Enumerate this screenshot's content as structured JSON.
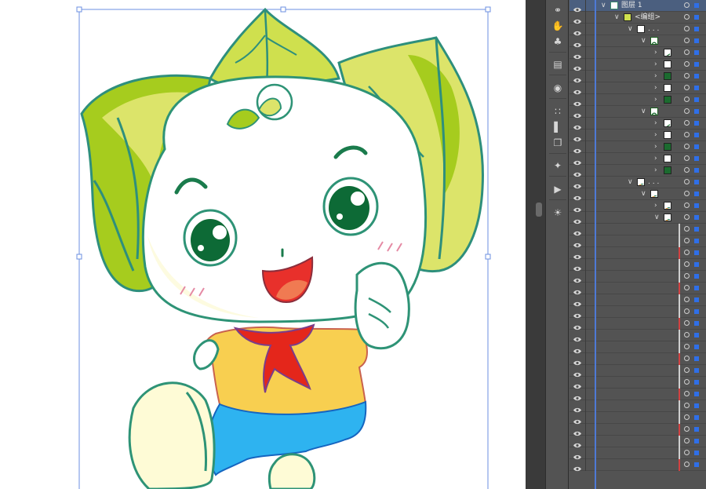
{
  "layers_panel": {
    "top_layer_label": "图层 1",
    "group_label": "<编组>",
    "ellipsis_label": ". . .",
    "rows": [
      {
        "depth": 0,
        "expanded": true,
        "thumb": "layer",
        "label_key": "top_layer_label",
        "selected": true
      },
      {
        "depth": 1,
        "expanded": true,
        "thumb": "art",
        "label_key": "group_label"
      },
      {
        "depth": 2,
        "expanded": true,
        "thumb": "white",
        "label_key": "ellipsis_label"
      },
      {
        "depth": 3,
        "expanded": true,
        "thumb": "ring"
      },
      {
        "depth": 4,
        "expanded": false,
        "thumb": "leafstroke"
      },
      {
        "depth": 4,
        "expanded": false,
        "thumb": "white"
      },
      {
        "depth": 4,
        "expanded": false,
        "thumb": "darkgreen"
      },
      {
        "depth": 4,
        "expanded": false,
        "thumb": "white"
      },
      {
        "depth": 4,
        "expanded": false,
        "thumb": "darkgreen"
      },
      {
        "depth": 3,
        "expanded": true,
        "thumb": "ring"
      },
      {
        "depth": 4,
        "expanded": false,
        "thumb": "leafstroke"
      },
      {
        "depth": 4,
        "expanded": false,
        "thumb": "white"
      },
      {
        "depth": 4,
        "expanded": false,
        "thumb": "darkgreen"
      },
      {
        "depth": 4,
        "expanded": false,
        "thumb": "white"
      },
      {
        "depth": 4,
        "expanded": false,
        "thumb": "darkgreen"
      },
      {
        "depth": 2,
        "expanded": true,
        "thumb": "mixed",
        "label_key": "ellipsis_label"
      },
      {
        "depth": 3,
        "expanded": true,
        "thumb": "mixed"
      },
      {
        "depth": 4,
        "expanded": false,
        "thumb": "mixed"
      },
      {
        "depth": 4,
        "expanded": true,
        "thumb": "mixed"
      }
    ],
    "empty_rows": 21
  },
  "toolbar_icons": [
    "link-icon",
    "puppet-warp-icon",
    "symbol-sprayer-icon",
    "gradient-icon",
    "shape-builder-icon",
    "align-grid-icon",
    "align-left-icon",
    "pathfinder-icon",
    "magic-wand-icon",
    "play-icon",
    "sun-brightness-icon"
  ],
  "colors": {
    "accent_selection": "#2f6fe8",
    "leaf_light": "#dce46a",
    "leaf_dark": "#a6cc1e",
    "outline_teal": "#2e9376",
    "shirt_yellow": "#f8cf50",
    "scarf_red": "#e4261b",
    "shorts_blue": "#2eb3f0"
  }
}
